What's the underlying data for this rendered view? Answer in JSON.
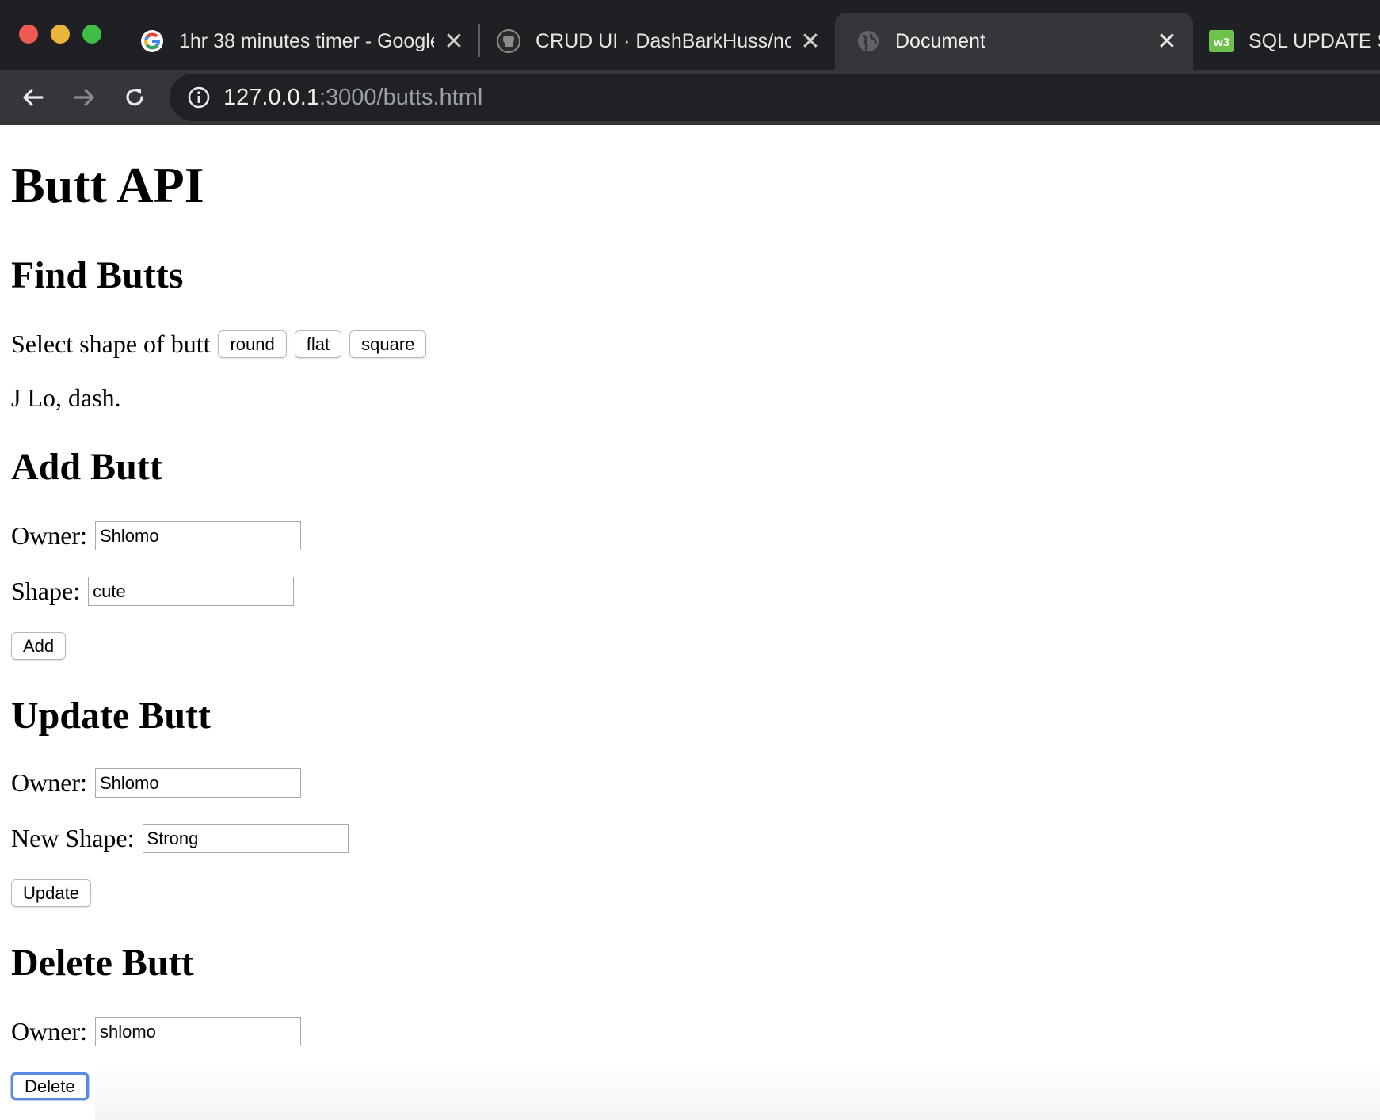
{
  "browser": {
    "tabs": [
      {
        "title": "1hr 38 minutes timer - Google",
        "icon": "google-g-icon"
      },
      {
        "title": "CRUD UI · DashBarkHuss/node",
        "icon": "github-icon"
      },
      {
        "title": "Document",
        "icon": "globe-icon",
        "active": true
      },
      {
        "title": "SQL UPDATE S",
        "icon": "w3schools-icon"
      }
    ],
    "url": {
      "host": "127.0.0.1",
      "path": ":3000/butts.html"
    }
  },
  "page": {
    "title": "Butt API",
    "find": {
      "heading": "Find Butts",
      "select_label": "Select shape of butt",
      "shape_buttons": [
        "round",
        "flat",
        "square"
      ],
      "result": "J Lo, dash."
    },
    "add": {
      "heading": "Add Butt",
      "owner_label": "Owner:",
      "owner_value": "Shlomo",
      "shape_label": "Shape:",
      "shape_value": "cute",
      "button": "Add"
    },
    "update": {
      "heading": "Update Butt",
      "owner_label": "Owner:",
      "owner_value": "Shlomo",
      "shape_label": "New Shape:",
      "shape_value": "Strong",
      "button": "Update"
    },
    "delete": {
      "heading": "Delete Butt",
      "owner_label": "Owner:",
      "owner_value": "shlomo",
      "button": "Delete"
    }
  },
  "colors": {
    "titlebar": "#1f2023",
    "toolbar": "#35363a",
    "omnibox": "#202124",
    "focus_ring": "#5a8ae0"
  }
}
